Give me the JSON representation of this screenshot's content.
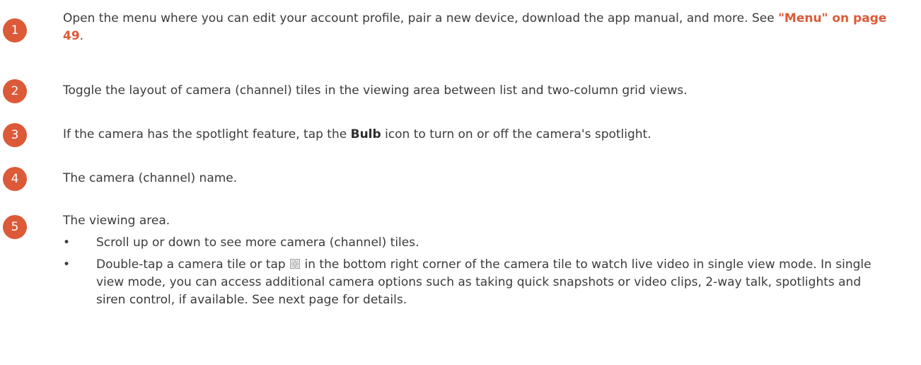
{
  "items": [
    {
      "number": "1",
      "text_before": "Open the menu where you can edit your account profile, pair a new device, download the app manual, and more. See ",
      "link": "\"Menu\" on page 49",
      "text_after": "."
    },
    {
      "number": "2",
      "text": "Toggle the layout of camera (channel) tiles in the viewing area between list and two-column grid views."
    },
    {
      "number": "3",
      "text_before": "If the camera has the spotlight feature, tap the ",
      "bold": "Bulb",
      "text_after": " icon to turn on or off the camera's spotlight."
    },
    {
      "number": "4",
      "text": "The camera (channel) name."
    },
    {
      "number": "5",
      "text": "The viewing area.",
      "bullets": [
        {
          "symbol": "•",
          "text": "Scroll up or down to see more camera (channel) tiles."
        },
        {
          "symbol": "•",
          "text_before": "Double-tap a camera tile or tap ",
          "icon": "expand-tile-icon",
          "text_after": " in the bottom right corner of the camera tile to watch live video in single view mode. In single view mode, you can access additional camera options such as taking quick snapshots or video clips, 2-way talk, spotlights and siren control, if available. See next page for details."
        }
      ]
    }
  ],
  "colors": {
    "accent": "#dc5a38",
    "text": "#3b3b3b"
  }
}
